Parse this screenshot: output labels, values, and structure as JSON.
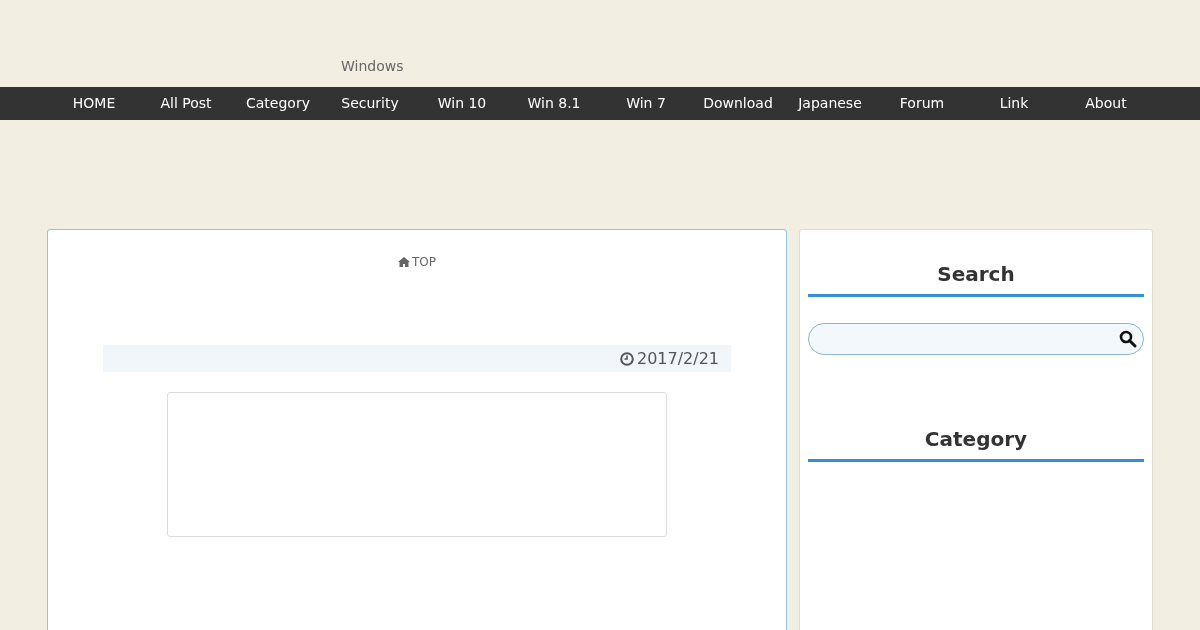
{
  "header": {
    "site_description": "Windows"
  },
  "nav": {
    "items": [
      {
        "label": "HOME"
      },
      {
        "label": "All Post"
      },
      {
        "label": "Category"
      },
      {
        "label": "Security"
      },
      {
        "label": "Win 10"
      },
      {
        "label": "Win 8.1"
      },
      {
        "label": "Win 7"
      },
      {
        "label": "Download"
      },
      {
        "label": "Japanese"
      },
      {
        "label": "Forum"
      },
      {
        "label": "Link"
      },
      {
        "label": "About"
      }
    ]
  },
  "breadcrumb": {
    "label": "TOP"
  },
  "post": {
    "date": "2017/2/21"
  },
  "sidebar": {
    "widgets": [
      {
        "kind": "search",
        "title": "Search"
      },
      {
        "kind": "list",
        "title": "Category"
      }
    ]
  }
}
